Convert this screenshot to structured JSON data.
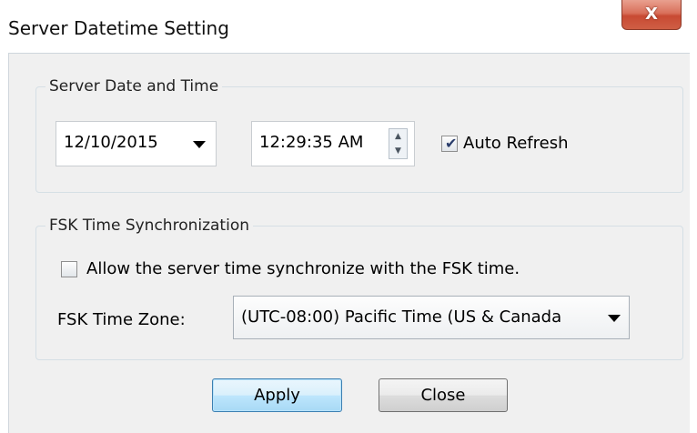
{
  "window": {
    "title": "Server Datetime Setting",
    "close_glyph": "X"
  },
  "server_datetime": {
    "group_title": "Server Date and Time",
    "date_value": "12/10/2015",
    "time_value": "12:29:35 AM",
    "auto_refresh_label": "Auto Refresh",
    "auto_refresh_checked": true
  },
  "fsk_sync": {
    "group_title": "FSK Time Synchronization",
    "allow_sync_label": "Allow the server time synchronize with the FSK time.",
    "allow_sync_checked": false,
    "time_zone_label": "FSK Time Zone:",
    "time_zone_value": "(UTC-08:00) Pacific Time (US & Canada"
  },
  "buttons": {
    "apply_label": "Apply",
    "close_label": "Close"
  },
  "icons": {
    "dropdown": "chevron-down-icon",
    "spin": "spin-arrows-icon",
    "check": "check-icon",
    "close": "close-icon"
  }
}
